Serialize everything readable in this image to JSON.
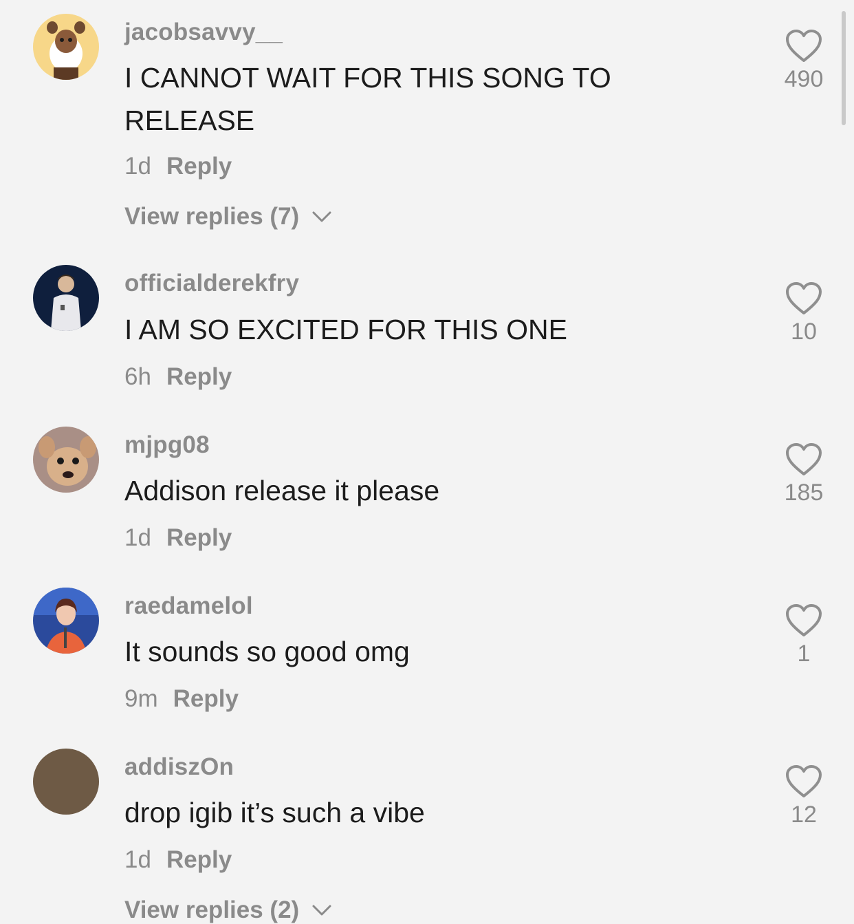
{
  "comments": [
    {
      "username": "jacobsavvy__",
      "text": "I CANNOT WAIT FOR THIS SONG TO RELEASE",
      "time": "1d",
      "reply_label": "Reply",
      "view_replies": "View replies (7)",
      "likes": "490",
      "avatar_color": "#f7d789",
      "like_icon": "heart-outline-icon"
    },
    {
      "username": "officialderekfry",
      "text": "I AM SO EXCITED FOR THIS ONE",
      "time": "6h",
      "reply_label": "Reply",
      "likes": "10",
      "avatar_color": "#0f1f3d",
      "like_icon": "heart-outline-icon"
    },
    {
      "username": "mjpg08",
      "text": "Addison release it please",
      "time": "1d",
      "reply_label": "Reply",
      "likes": "185",
      "avatar_color": "#a98f86",
      "like_icon": "heart-outline-icon"
    },
    {
      "username": "raedamelol",
      "text": "It sounds so good omg",
      "time": "9m",
      "reply_label": "Reply",
      "likes": "1",
      "avatar_color": "#2b4a9c",
      "like_icon": "heart-outline-icon"
    },
    {
      "username": "addiszOn",
      "text": "drop igib it’s such a vibe",
      "time": "1d",
      "reply_label": "Reply",
      "view_replies": "View replies (2)",
      "likes": "12",
      "avatar_color": "#6e5a45",
      "like_icon": "heart-outline-icon"
    }
  ]
}
